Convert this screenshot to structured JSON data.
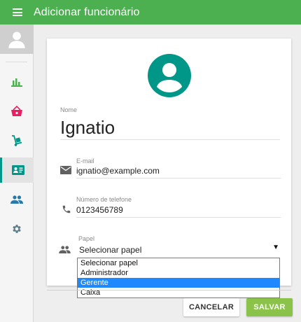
{
  "appbar": {
    "title": "Adicionar funcionário"
  },
  "sidebar": {
    "items": [
      {
        "icon": "bar-chart-icon",
        "color": "#4caf50"
      },
      {
        "icon": "basket-icon",
        "color": "#e91e63"
      },
      {
        "icon": "hand-truck-icon",
        "color": "#009688"
      },
      {
        "icon": "id-card-icon",
        "color": "#009688",
        "active": true
      },
      {
        "icon": "people-icon",
        "color": "#2979a8"
      },
      {
        "icon": "gear-icon",
        "color": "#607d8b"
      }
    ]
  },
  "form": {
    "name_label": "Nome",
    "name_value": "Ignatio",
    "email_label": "E-mail",
    "email_value": "ignatio@example.com",
    "phone_label": "Número de telefone",
    "phone_value": "0123456789",
    "role_label": "Papel",
    "role_value": "Selecionar papel",
    "role_options": [
      "Selecionar papel",
      "Administrador",
      "Gerente",
      "Caixa"
    ],
    "role_highlighted": "Gerente"
  },
  "actions": {
    "cancel_label": "CANCELAR",
    "save_label": "SALVAR"
  },
  "colors": {
    "appbar": "#4caf50",
    "avatar": "#009688",
    "save": "#8bc34a",
    "highlight": "#1e88ff"
  }
}
